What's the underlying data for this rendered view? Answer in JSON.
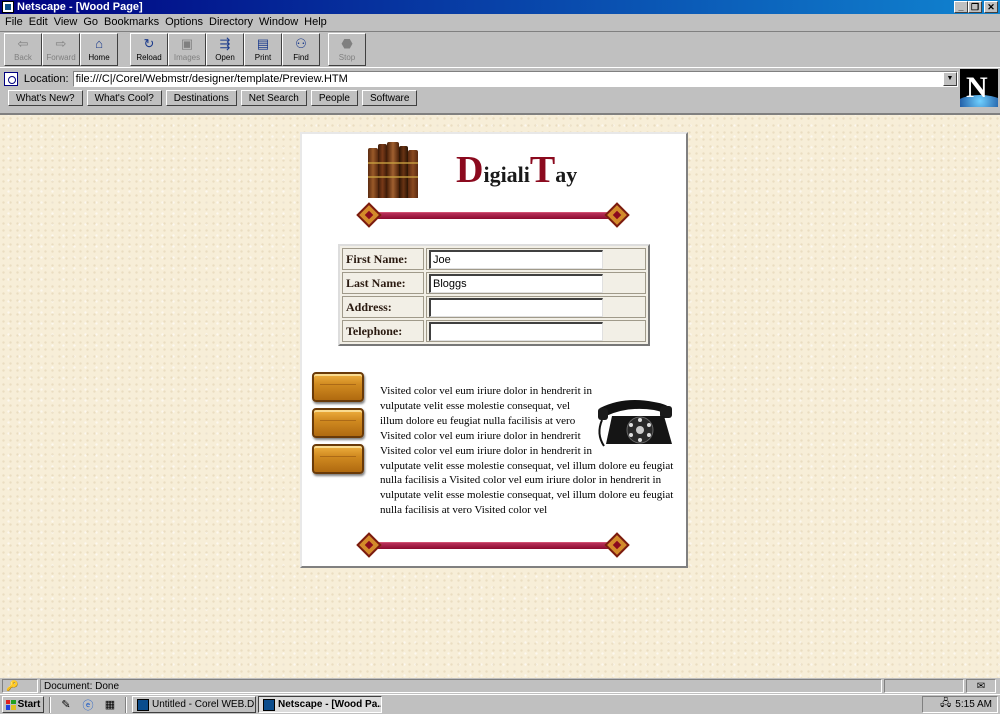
{
  "window": {
    "title": "Netscape - [Wood Page]"
  },
  "menu": [
    "File",
    "Edit",
    "View",
    "Go",
    "Bookmarks",
    "Options",
    "Directory",
    "Window",
    "Help"
  ],
  "toolbar": {
    "back": "Back",
    "forward": "Forward",
    "home": "Home",
    "reload": "Reload",
    "images": "Images",
    "open": "Open",
    "print": "Print",
    "find": "Find",
    "stop": "Stop"
  },
  "location": {
    "label": "Location:",
    "url": "file:///C|/Corel/Webmstr/designer/template/Preview.HTM"
  },
  "directory_buttons": [
    "What's New?",
    "What's Cool?",
    "Destinations",
    "Net Search",
    "People",
    "Software"
  ],
  "page": {
    "title_cap1": "D",
    "title_rest1": "igiali",
    "title_cap2": "T",
    "title_rest2": "ay",
    "form": {
      "first_name_label": "First Name:",
      "first_name_value": "Joe",
      "last_name_label": "Last Name:",
      "last_name_value": "Bloggs",
      "address_label": "Address:",
      "address_value": "",
      "telephone_label": "Telephone:",
      "telephone_value": ""
    },
    "body_text": "Visited color vel eum iriure dolor in hendrerit in vulputate velit esse molestie consequat, vel illum dolore eu feugiat nulla facilisis at vero Visited color vel eum iriure dolor in hendrerit Visited color vel eum iriure dolor in hendrerit in vulputate velit esse molestie consequat, vel illum dolore eu feugiat nulla facilisis a Visited color vel eum iriure dolor in hendrerit in vulputate velit esse molestie consequat, vel illum dolore eu feugiat nulla facilisis at vero Visited color vel"
  },
  "status": {
    "text": "Document: Done"
  },
  "taskbar": {
    "start": "Start",
    "tasks": [
      "Untitled - Corel WEB.DESI...",
      "Netscape - [Wood Pa..."
    ],
    "clock": "5:15 AM"
  },
  "colors": {
    "title_accent": "#8b0a1e",
    "rule": "#9a1438",
    "titlebar": "#000080"
  }
}
